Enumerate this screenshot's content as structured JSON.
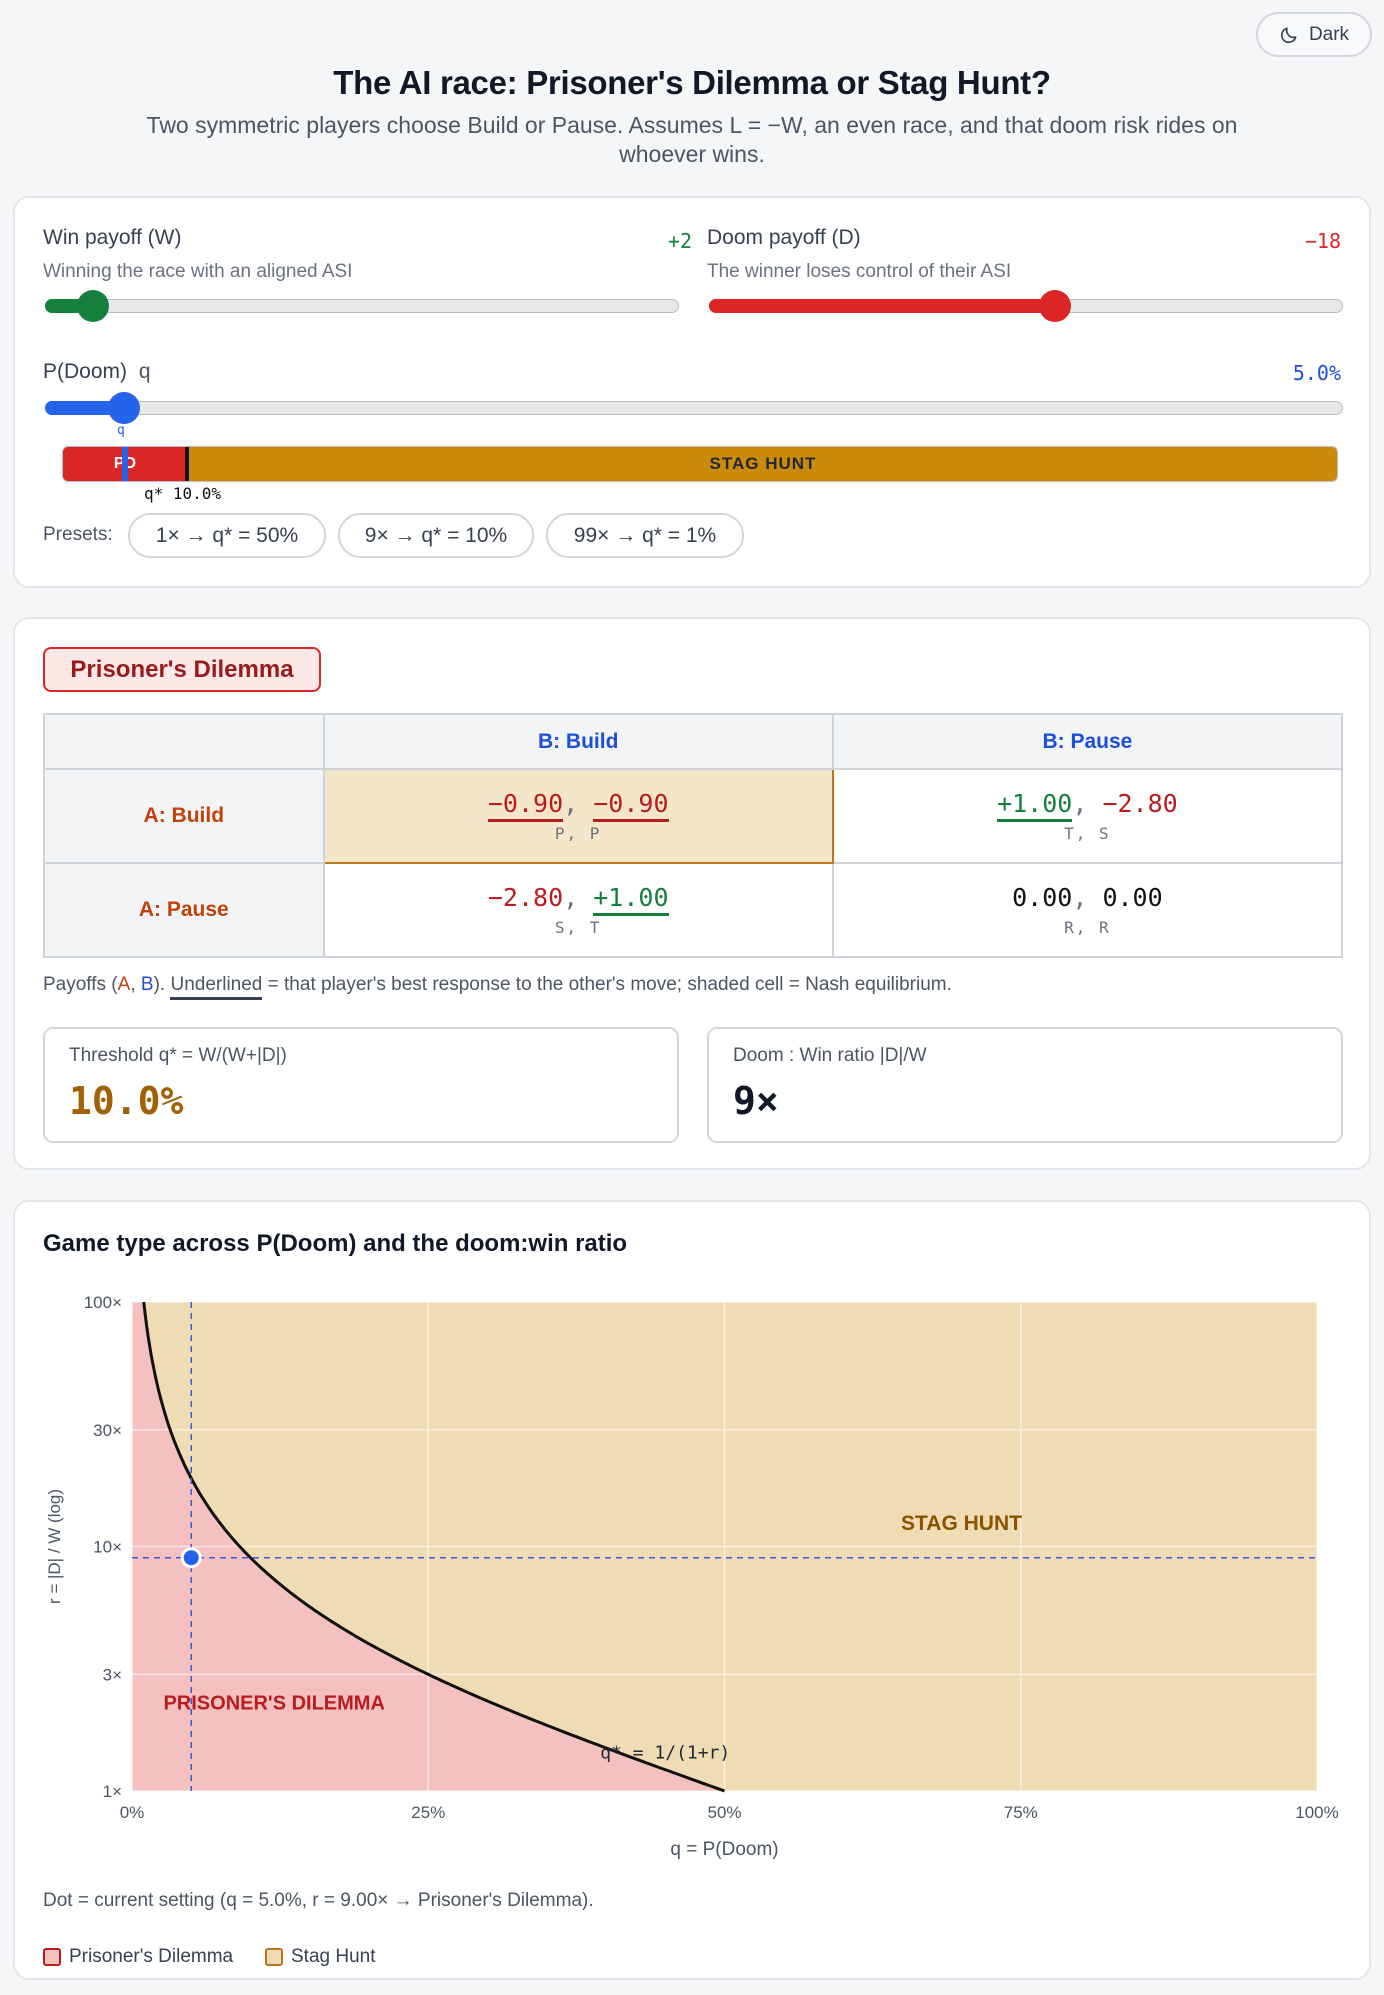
{
  "theme_toggle": {
    "label": "Dark",
    "icon": "moon-icon"
  },
  "header": {
    "title": "The AI race: Prisoner's Dilemma or Stag Hunt?",
    "subtitle": "Two symmetric players choose Build or Pause. Assumes L = −W, an even race, and that doom risk rides on whoever wins."
  },
  "controls": {
    "win": {
      "label": "Win payoff (W)",
      "description": "Winning the race with an aligned ASI",
      "value_text": "+2",
      "value": 2,
      "min": 0,
      "max": 40
    },
    "doom": {
      "label": "Doom payoff (D)",
      "description": "The winner loses control of their ASI",
      "value_text": "−18",
      "value": -18,
      "min": -34,
      "max": 0
    },
    "pdoom": {
      "label": "P(Doom)",
      "symbol": "q",
      "value_text": "5.0%",
      "value": 0.05,
      "marker_label": "q"
    },
    "regime_bar": {
      "pd_label": "PD",
      "sh_label": "STAG HUNT",
      "threshold_label": "q* 10.0%",
      "threshold": 0.1
    },
    "presets_label": "Presets:",
    "presets": [
      "1× → q* = 50%",
      "9× → q* = 10%",
      "99× → q* = 1%"
    ]
  },
  "game": {
    "badge": "Prisoner's Dilemma",
    "col_headers": [
      "B: Build",
      "B: Pause"
    ],
    "row_headers": [
      "A: Build",
      "A: Pause"
    ],
    "cells": {
      "bb": {
        "a": "−0.90",
        "b": "−0.90",
        "tags": "P, P"
      },
      "bp": {
        "a": "+1.00",
        "b": "−2.80",
        "tags": "T, S"
      },
      "pb": {
        "a": "−2.80",
        "b": "+1.00",
        "tags": "S, T"
      },
      "pp": {
        "a": "0.00",
        "b": "0.00",
        "tags": "R, R"
      }
    },
    "note": {
      "prefix": "Payoffs (",
      "a": "A",
      "sep": ", ",
      "b": "B",
      "mid": "). ",
      "underlined": "Underlined",
      "suffix": " = that player's best response to the other's move; shaded cell = Nash equilibrium."
    },
    "threshold": {
      "label": "Threshold q* = W/(W+|D|)",
      "value": "10.0%"
    },
    "ratio": {
      "label": "Doom : Win ratio |D|/W",
      "value": "9×"
    }
  },
  "chart_data": {
    "type": "area",
    "title": "Game type across P(Doom) and the doom:win ratio",
    "xlabel": "q = P(Doom)",
    "ylabel": "r = |D| / W (log)",
    "xlim": [
      0,
      1
    ],
    "ylim": [
      1,
      100
    ],
    "y_scale": "log",
    "x_ticks": [
      "0%",
      "25%",
      "50%",
      "75%",
      "100%"
    ],
    "x_tick_values": [
      0,
      0.25,
      0.5,
      0.75,
      1
    ],
    "y_ticks": [
      "1×",
      "3×",
      "10×",
      "30×",
      "100×"
    ],
    "y_tick_values": [
      1,
      3,
      10,
      30,
      100
    ],
    "grid": true,
    "boundary": {
      "equation": "q* = 1/(1+r)",
      "label": "q* = 1/(1+r)"
    },
    "regions": [
      {
        "name": "PRISONER'S DILEMMA",
        "color": "#f4c0c0",
        "label_color": "#b91c1c"
      },
      {
        "name": "STAG HUNT",
        "color": "#f0dcb4",
        "label_color": "#8a5300"
      }
    ],
    "current": {
      "q": 0.05,
      "r": 9.0
    },
    "caption": "Dot = current setting (q = 5.0%, r = 9.00× → Prisoner's Dilemma).",
    "legend": [
      "Prisoner's Dilemma",
      "Stag Hunt"
    ],
    "legend_colors": [
      "#f4c0c0",
      "#f0dcb4"
    ]
  }
}
